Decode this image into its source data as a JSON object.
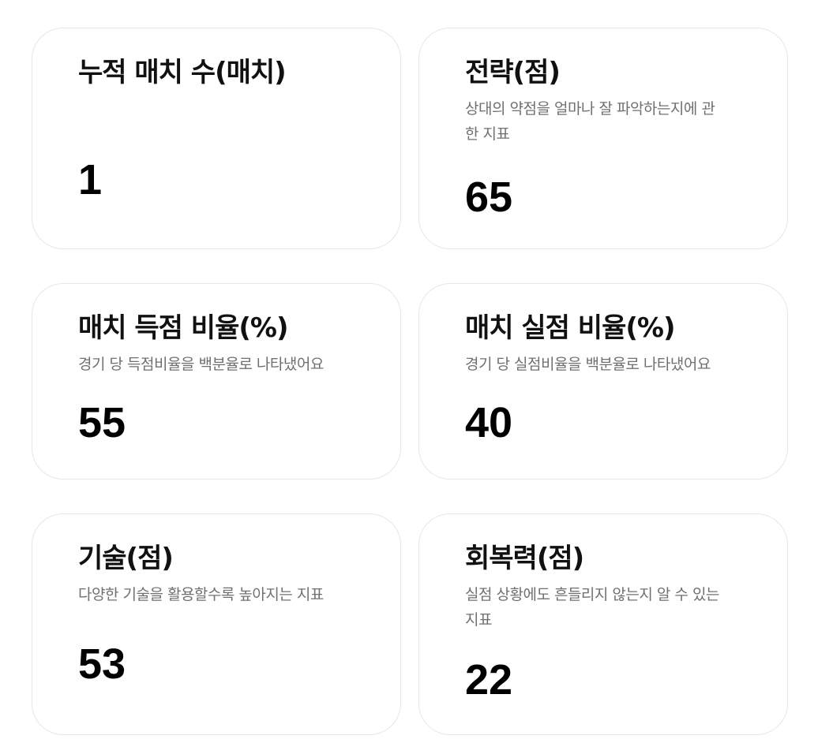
{
  "stats": [
    {
      "title": "누적 매치 수(매치)",
      "description": "",
      "value": "1"
    },
    {
      "title": "전략(점)",
      "description": "상대의 약점을 얼마나 잘 파악하는지에 관한 지표",
      "value": "65"
    },
    {
      "title": "매치 득점 비율(%)",
      "description": "경기 당 득점비율을 백분율로 나타냈어요",
      "value": "55"
    },
    {
      "title": "매치 실점 비율(%)",
      "description": "경기 당 실점비율을 백분율로 나타냈어요",
      "value": "40"
    },
    {
      "title": "기술(점)",
      "description": "다양한 기술을 활용할수록 높아지는 지표",
      "value": "53"
    },
    {
      "title": "회복력(점)",
      "description": "실점 상황에도 흔들리지 않는지 알 수 있는 지표",
      "value": "22"
    }
  ]
}
